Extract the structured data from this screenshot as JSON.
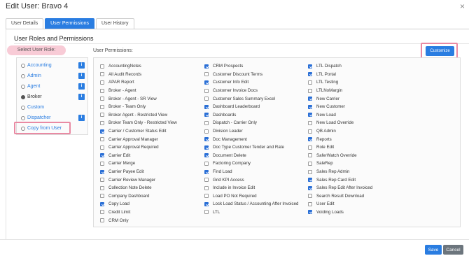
{
  "window": {
    "title": "Edit User: Bravo 4",
    "close_glyph": "×"
  },
  "tabs": [
    {
      "label": "User Details",
      "active": false
    },
    {
      "label": "User Permissions",
      "active": true
    },
    {
      "label": "User History",
      "active": false
    }
  ],
  "section_title": "User Roles and Permissions",
  "roles": {
    "label": "Select User Role:",
    "items": [
      {
        "label": "Accounting",
        "selected": false,
        "info": true
      },
      {
        "label": "Admin",
        "selected": false,
        "info": true
      },
      {
        "label": "Agent",
        "selected": false,
        "info": true
      },
      {
        "label": "Broker",
        "selected": true,
        "info": true
      },
      {
        "label": "Custom",
        "selected": false,
        "info": false
      },
      {
        "label": "Dispatcher",
        "selected": false,
        "info": true
      },
      {
        "label": "Copy from User",
        "selected": false,
        "info": false
      }
    ],
    "info_glyph": "i"
  },
  "permissions": {
    "label": "User Permissions:",
    "customize_label": "Customize",
    "columns": [
      [
        {
          "label": "AccountingNotes",
          "checked": false
        },
        {
          "label": "All Audit Records",
          "checked": false
        },
        {
          "label": "APAR Report",
          "checked": false
        },
        {
          "label": "Broker - Agent",
          "checked": false
        },
        {
          "label": "Broker - Agent - SR View",
          "checked": false
        },
        {
          "label": "Broker - Team Only",
          "checked": false
        },
        {
          "label": "Broker Agent - Restricted View",
          "checked": false
        },
        {
          "label": "Broker Team Only - Restricted View",
          "checked": false
        },
        {
          "label": "Carrier / Customer Status Edit",
          "checked": true
        },
        {
          "label": "Carrier Approval Manager",
          "checked": false
        },
        {
          "label": "Carrier Approval Required",
          "checked": false
        },
        {
          "label": "Carrier Edit",
          "checked": true
        },
        {
          "label": "Carrier Merge",
          "checked": false
        },
        {
          "label": "Carrier Payee Edit",
          "checked": true
        },
        {
          "label": "Carrier Review Manager",
          "checked": false
        },
        {
          "label": "Collection Note Delete",
          "checked": false
        },
        {
          "label": "Company Dashboard",
          "checked": false
        },
        {
          "label": "Copy Load",
          "checked": true
        },
        {
          "label": "Credit Limit",
          "checked": false
        },
        {
          "label": "CRM Only",
          "checked": false
        }
      ],
      [
        {
          "label": "CRM Prospects",
          "checked": true
        },
        {
          "label": "Customer Discount Terms",
          "checked": false
        },
        {
          "label": "Customer Info Edit",
          "checked": true
        },
        {
          "label": "Customer Invoice Docs",
          "checked": false
        },
        {
          "label": "Customer Sales Summary Excel",
          "checked": false
        },
        {
          "label": "Dashboard Leaderboard",
          "checked": true
        },
        {
          "label": "Dashboards",
          "checked": true
        },
        {
          "label": "Dispatch - Carrier Only",
          "checked": false
        },
        {
          "label": "Division Leader",
          "checked": false
        },
        {
          "label": "Doc Management",
          "checked": true
        },
        {
          "label": "Doc Type Customer Tender and Rate",
          "checked": true
        },
        {
          "label": "Document Delete",
          "checked": true
        },
        {
          "label": "Factoring Company",
          "checked": false
        },
        {
          "label": "Find Load",
          "checked": true
        },
        {
          "label": "Grid KPI Access",
          "checked": false
        },
        {
          "label": "Include in Invoice Edit",
          "checked": false
        },
        {
          "label": "Load PO Not Required",
          "checked": false
        },
        {
          "label": "Lock Load Status / Accounting After Invoiced",
          "checked": true
        },
        {
          "label": "LTL",
          "checked": false
        }
      ],
      [
        {
          "label": "LTL Dispatch",
          "checked": true
        },
        {
          "label": "LTL Portal",
          "checked": true
        },
        {
          "label": "LTL Testing",
          "checked": false
        },
        {
          "label": "LTLNoMargin",
          "checked": false
        },
        {
          "label": "New Carrier",
          "checked": true
        },
        {
          "label": "New Customer",
          "checked": true
        },
        {
          "label": "New Load",
          "checked": true
        },
        {
          "label": "New Load Override",
          "checked": false
        },
        {
          "label": "QB Admin",
          "checked": false
        },
        {
          "label": "Reports",
          "checked": true
        },
        {
          "label": "Role Edit",
          "checked": false
        },
        {
          "label": "SaferWatch Override",
          "checked": false
        },
        {
          "label": "SaleRep",
          "checked": false
        },
        {
          "label": "Sales Rep Admin",
          "checked": false
        },
        {
          "label": "Sales Rep Card Edit",
          "checked": true
        },
        {
          "label": "Sales Rep Edit After Invoiced",
          "checked": true
        },
        {
          "label": "Search Result Download",
          "checked": false
        },
        {
          "label": "User Edit",
          "checked": false
        },
        {
          "label": "Voiding Loads",
          "checked": true
        }
      ]
    ]
  },
  "footer": {
    "save_label": "Save",
    "cancel_label": "Cancel"
  },
  "colors": {
    "accent": "#2a7de1",
    "highlight": "#e98aa3",
    "role_label_bg": "#f8cbd6",
    "cancel": "#6c757d"
  }
}
